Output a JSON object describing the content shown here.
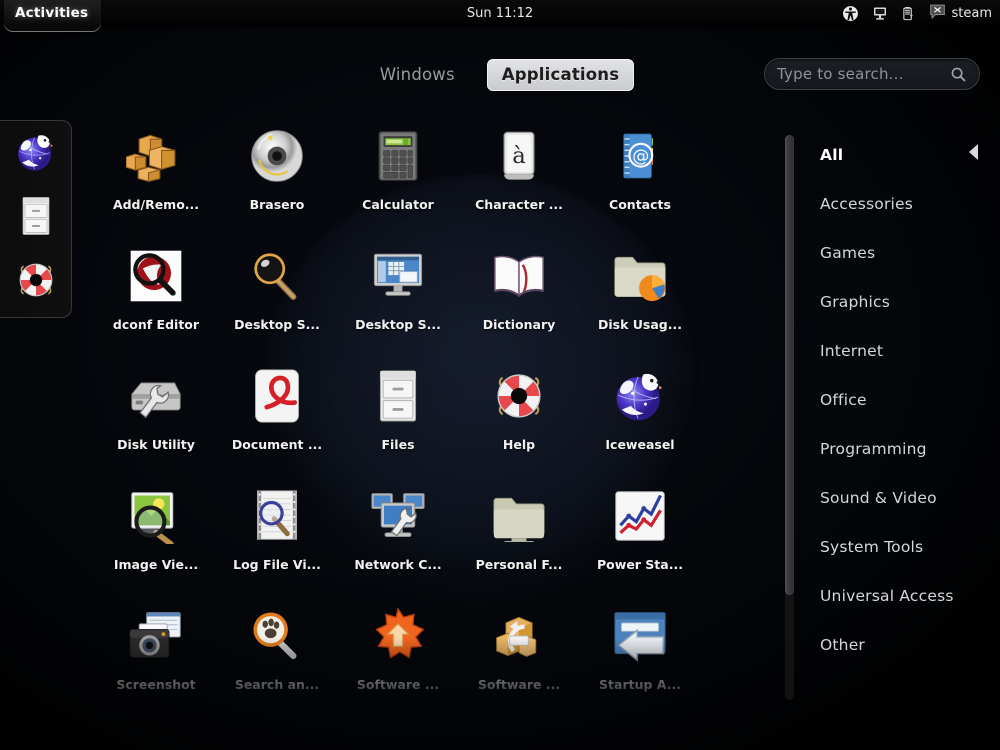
{
  "panel": {
    "activities_label": "Activities",
    "clock": "Sun 11:12",
    "status_icons": [
      {
        "name": "accessibility-icon",
        "title": "Universal Access"
      },
      {
        "name": "display-icon",
        "title": "Display"
      },
      {
        "name": "battery-icon",
        "title": "Battery"
      }
    ],
    "steam_label": "steam"
  },
  "tabs": [
    {
      "label": "Windows",
      "selected": false
    },
    {
      "label": "Applications",
      "selected": true
    }
  ],
  "search": {
    "placeholder": "Type to search...",
    "value": "",
    "icon": "search-icon"
  },
  "dash": {
    "items": [
      {
        "label": "Iceweasel",
        "icon": "iceweasel-icon"
      },
      {
        "label": "Files",
        "icon": "file-cabinet-icon"
      },
      {
        "label": "Help",
        "icon": "life-ring-icon"
      }
    ]
  },
  "apps": [
    {
      "label": "Add/Remo...",
      "icon": "packages-icon"
    },
    {
      "label": "Brasero",
      "icon": "cd-disc-icon"
    },
    {
      "label": "Calculator",
      "icon": "calculator-icon"
    },
    {
      "label": "Character ...",
      "icon": "keyboard-key-icon"
    },
    {
      "label": "Contacts",
      "icon": "address-book-icon"
    },
    {
      "label": "dconf Editor",
      "icon": "dconf-checkmark-icon"
    },
    {
      "label": "Desktop S...",
      "icon": "magnifier-black-icon"
    },
    {
      "label": "Desktop S...",
      "icon": "monitor-icon"
    },
    {
      "label": "Dictionary",
      "icon": "open-book-icon"
    },
    {
      "label": "Disk Usag...",
      "icon": "folder-pie-chart-icon"
    },
    {
      "label": "Disk Utility",
      "icon": "disk-wrench-icon"
    },
    {
      "label": "Document ...",
      "icon": "document-viewer-icon"
    },
    {
      "label": "Files",
      "icon": "file-cabinet-icon"
    },
    {
      "label": "Help",
      "icon": "life-ring-icon"
    },
    {
      "label": "Iceweasel",
      "icon": "iceweasel-icon"
    },
    {
      "label": "Image Vie...",
      "icon": "image-magnifier-icon"
    },
    {
      "label": "Log File Vi...",
      "icon": "log-magnifier-icon"
    },
    {
      "label": "Network C...",
      "icon": "network-wrench-icon"
    },
    {
      "label": "Personal F...",
      "icon": "folder-icon"
    },
    {
      "label": "Power Sta...",
      "icon": "chart-lines-icon"
    },
    {
      "label": "Screenshot",
      "icon": "camera-icon"
    },
    {
      "label": "Search an...",
      "icon": "magnifier-paw-icon"
    },
    {
      "label": "Software ...",
      "icon": "orange-star-update-icon"
    },
    {
      "label": "Software ...",
      "icon": "package-refresh-icon"
    },
    {
      "label": "Startup A...",
      "icon": "window-arrow-icon"
    }
  ],
  "categories": [
    {
      "label": "All",
      "selected": true
    },
    {
      "label": "Accessories",
      "selected": false
    },
    {
      "label": "Games",
      "selected": false
    },
    {
      "label": "Graphics",
      "selected": false
    },
    {
      "label": "Internet",
      "selected": false
    },
    {
      "label": "Office",
      "selected": false
    },
    {
      "label": "Programming",
      "selected": false
    },
    {
      "label": "Sound & Video",
      "selected": false
    },
    {
      "label": "System Tools",
      "selected": false
    },
    {
      "label": "Universal Access",
      "selected": false
    },
    {
      "label": "Other",
      "selected": false
    }
  ],
  "colors": {
    "panel_bg": "#050505",
    "selected_tab_bg": "#d5d7dc",
    "text": "#ffffff",
    "muted_text": "#9a9a9a",
    "accent_orange": "#f07010"
  }
}
